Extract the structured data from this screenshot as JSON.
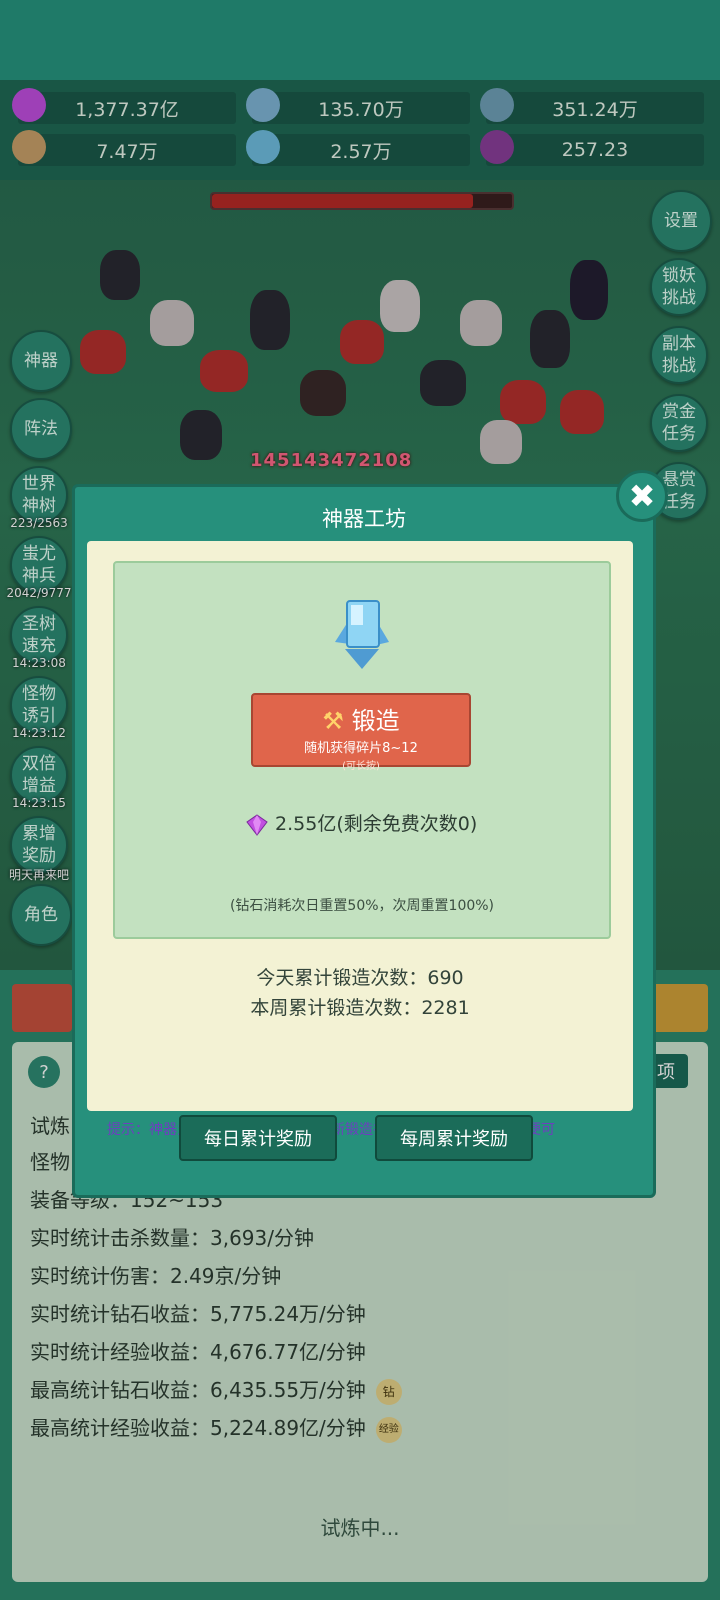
{
  "resources": [
    {
      "name": "diamond",
      "value": "1,377.37亿",
      "color": "#c14fe0"
    },
    {
      "name": "blue-gem",
      "value": "135.70万",
      "color": "#7fb5d6"
    },
    {
      "name": "rock",
      "value": "351.24万",
      "color": "#6fa0b8"
    },
    {
      "name": "scroll",
      "value": "7.47万",
      "color": "#c9a06a"
    },
    {
      "name": "ice-crystal",
      "value": "2.57万",
      "color": "#6fbde0"
    },
    {
      "name": "potion",
      "value": "257.23",
      "color": "#8a3f9a"
    }
  ],
  "boss_hp_fraction": 0.87,
  "damage_number": "145143472108",
  "left_buttons": [
    {
      "label": "神器",
      "sub": ""
    },
    {
      "label": "阵法",
      "sub": ""
    },
    {
      "label": "世界神树",
      "sub": "223/2563"
    },
    {
      "label": "蚩尤神兵",
      "sub": "2042/9777"
    },
    {
      "label": "圣树速充",
      "sub": "14:23:08"
    },
    {
      "label": "怪物诱引",
      "sub": "14:23:12"
    },
    {
      "label": "双倍增益",
      "sub": "14:23:15"
    },
    {
      "label": "累增奖励",
      "sub": "明天再来吧"
    },
    {
      "label": "角色",
      "sub": ""
    }
  ],
  "right_buttons": [
    "设置",
    "锁妖挑战",
    "副本挑战",
    "赏金任务",
    "悬赏任务"
  ],
  "modal": {
    "title": "神器工坊",
    "close": "✖",
    "forge_label": "锻造",
    "forge_desc": "随机获得碎片8~12",
    "forge_hint": "(可长按)",
    "cost": "2.55亿(剩余免费次数0)",
    "cost_note": "(钻石消耗次日重置50%，次周重置100%)",
    "today_count": "今天累计锻造次数：690",
    "week_count": "本周累计锻造次数：2281",
    "tip": "提示：神器为大后期功能，不建议萌新锻造神器，白嫖每日免费次数便可",
    "daily_button": "每日累计奖励",
    "weekly_button": "每周累计奖励"
  },
  "bottom": {
    "help": "?",
    "tab_right": "项",
    "lines_partial": [
      "试炼",
      "怪物",
      "装备等级：152~153"
    ],
    "stats": [
      "实时统计击杀数量：3,693/分钟",
      "实时统计伤害：2.49京/分钟",
      "实时统计钻石收益：5,775.24万/分钟",
      "实时统计经验收益：4,676.77亿/分钟",
      "最高统计钻石收益：6,435.55万/分钟",
      "最高统计经验收益：5,224.89亿/分钟"
    ],
    "badge_diamond": "钻",
    "badge_exp": "经验",
    "status": "试炼中..."
  }
}
